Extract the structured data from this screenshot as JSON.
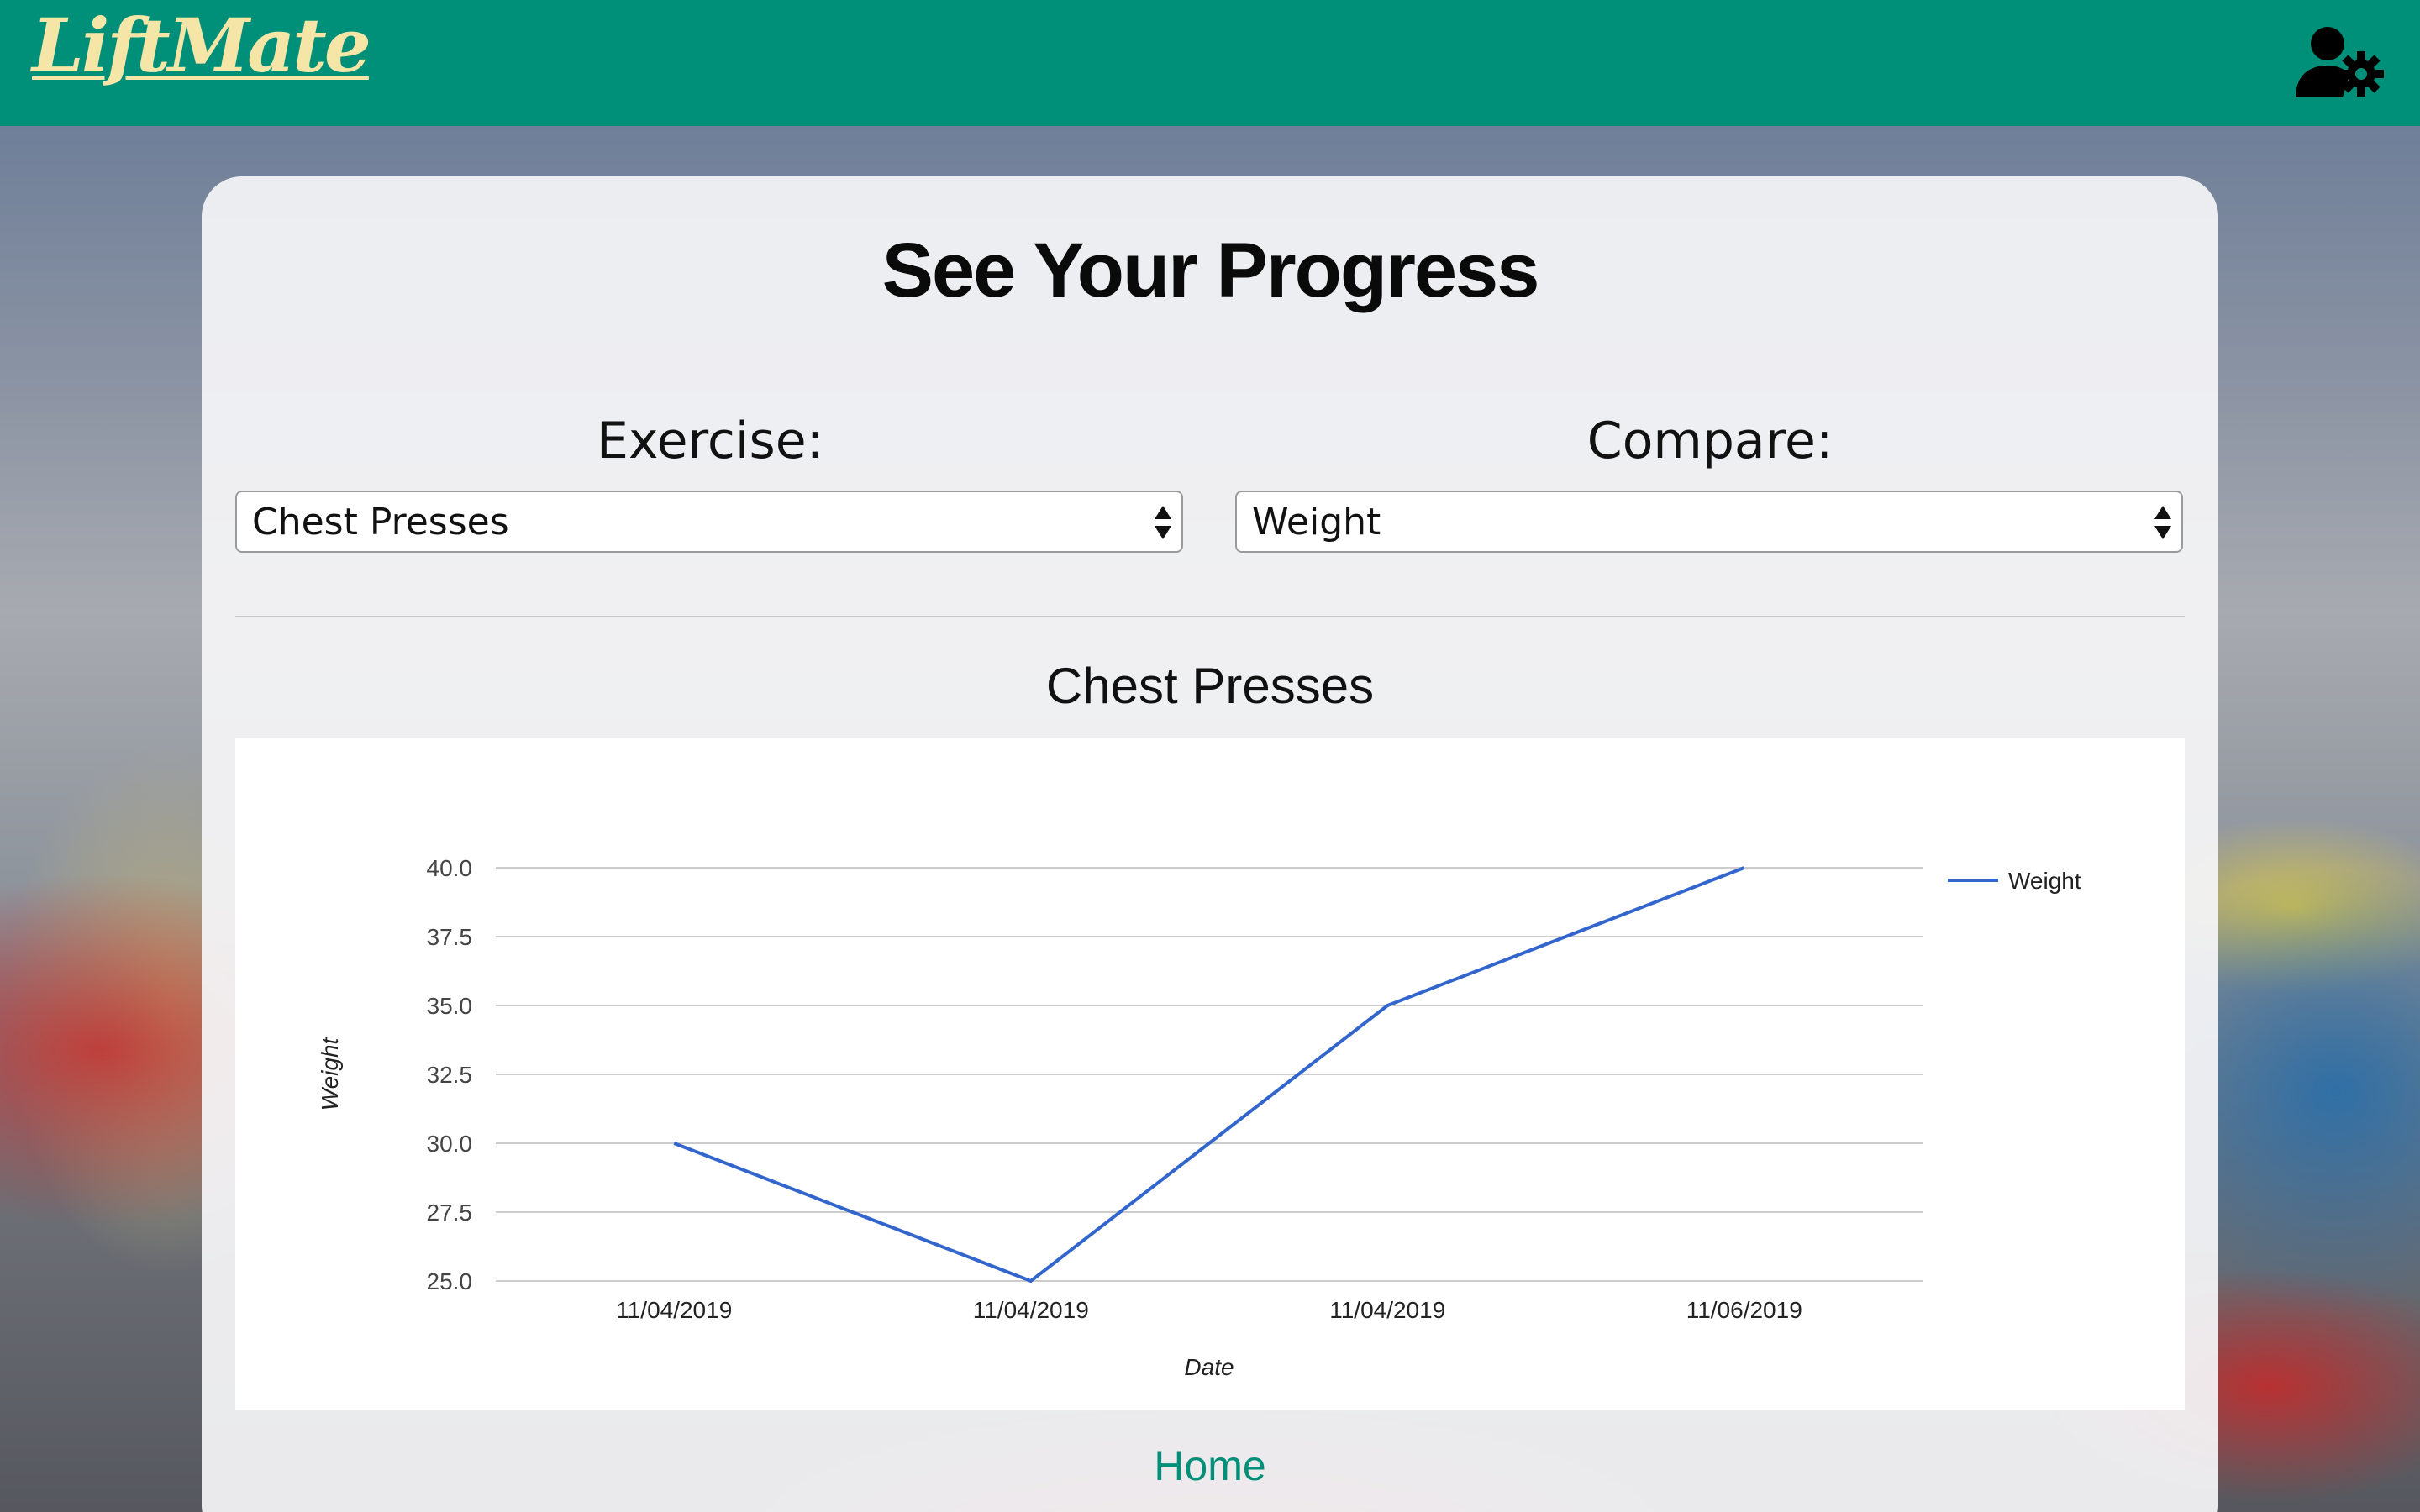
{
  "header": {
    "logo_text": "LiftMate",
    "account_icon": "user-settings-icon"
  },
  "page": {
    "title": "See Your Progress"
  },
  "filters": {
    "exercise_label": "Exercise:",
    "exercise_value": "Chest Presses",
    "compare_label": "Compare:",
    "compare_value": "Weight"
  },
  "chart_heading": "Chest Presses",
  "chart_data": {
    "type": "line",
    "categories": [
      "11/04/2019",
      "11/04/2019",
      "11/04/2019",
      "11/06/2019"
    ],
    "series": [
      {
        "name": "Weight",
        "values": [
          30.0,
          25.0,
          35.0,
          40.0
        ],
        "color": "#3366cc"
      }
    ],
    "xlabel": "Date",
    "ylabel": "Weight",
    "ylim": [
      25.0,
      40.0
    ],
    "yticks": [
      "40.0",
      "37.5",
      "35.0",
      "32.5",
      "30.0",
      "27.5",
      "25.0"
    ],
    "grid": true,
    "legend": "right"
  },
  "footer": {
    "home_label": "Home"
  },
  "colors": {
    "brand": "#008f78",
    "logo": "#f5e6a7",
    "series": "#3366cc"
  }
}
